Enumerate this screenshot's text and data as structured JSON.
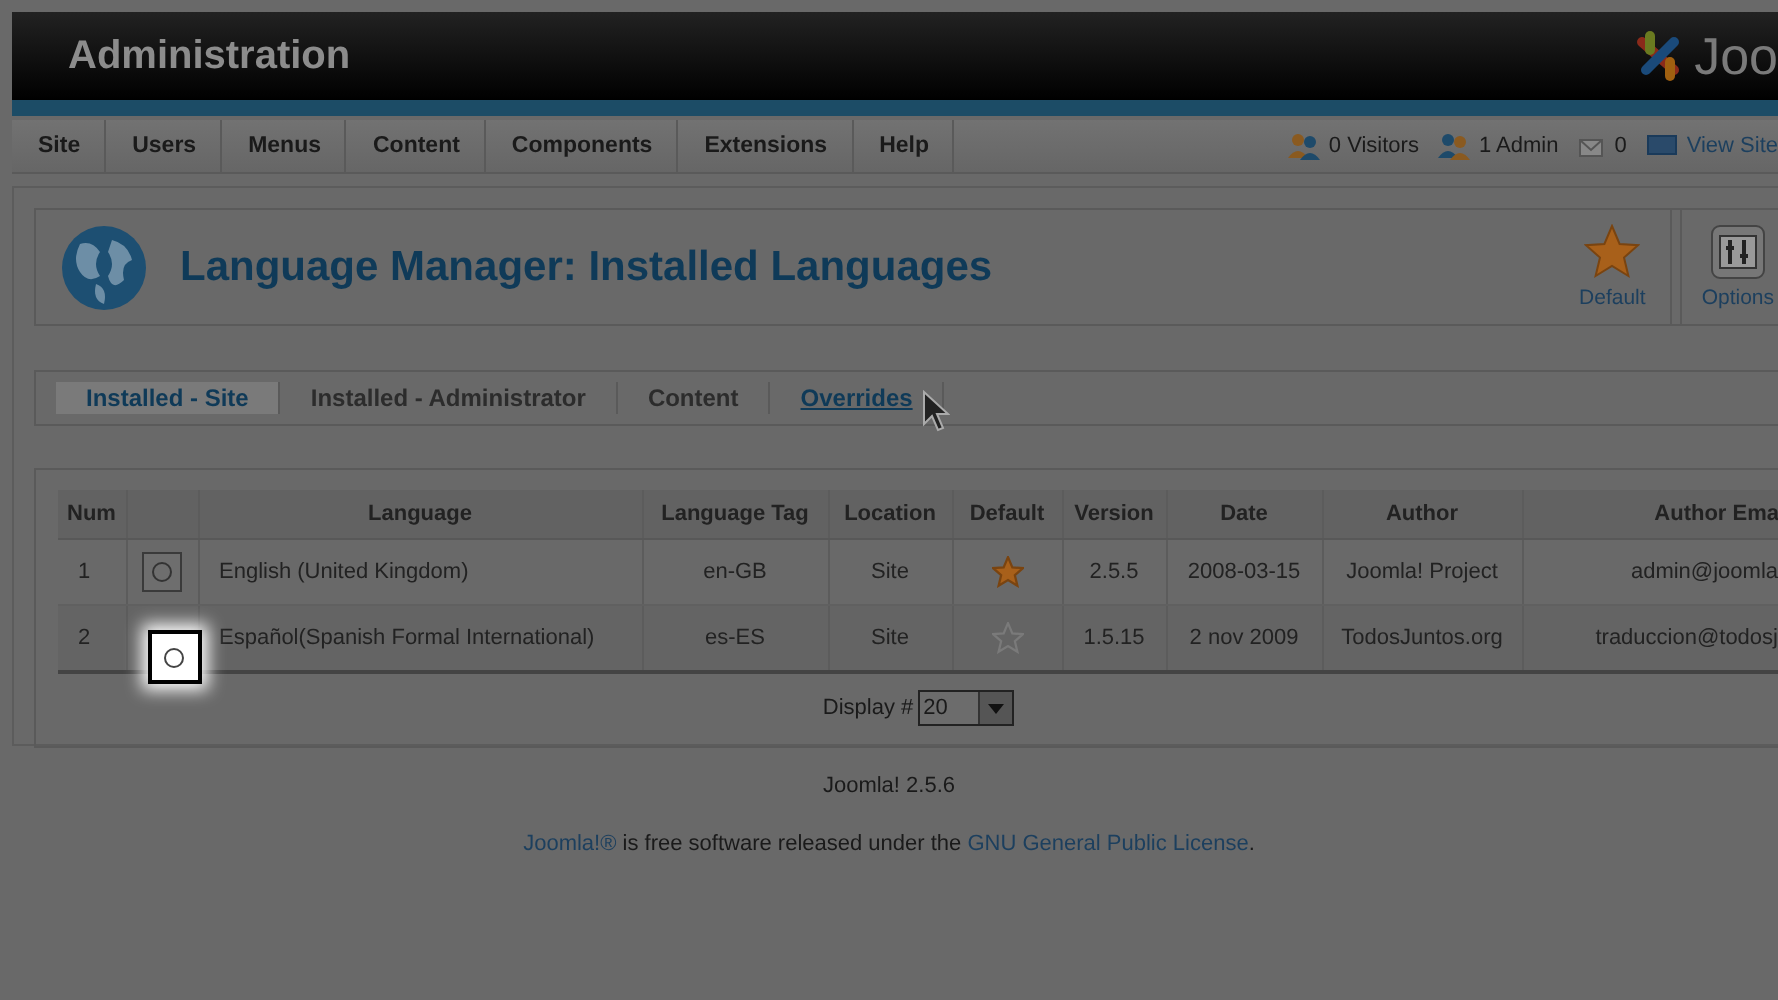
{
  "header": {
    "title": "Administration",
    "logo_text": "Joo"
  },
  "menu": [
    {
      "label": "Site"
    },
    {
      "label": "Users"
    },
    {
      "label": "Menus"
    },
    {
      "label": "Content"
    },
    {
      "label": "Components"
    },
    {
      "label": "Extensions"
    },
    {
      "label": "Help"
    }
  ],
  "status": [
    {
      "kind": "visitors",
      "label": "0 Visitors"
    },
    {
      "kind": "admins",
      "label": "1 Admin"
    },
    {
      "kind": "messages",
      "label": "0"
    },
    {
      "kind": "view",
      "label": "View Site"
    }
  ],
  "page_title": "Language Manager: Installed Languages",
  "toolbar": [
    {
      "kind": "default",
      "label": "Default"
    },
    {
      "kind": "options",
      "label": "Options"
    }
  ],
  "tabs": [
    {
      "label": "Installed - Site",
      "selected": true,
      "hovered": false
    },
    {
      "label": "Installed - Administrator",
      "selected": false,
      "hovered": false
    },
    {
      "label": "Content",
      "selected": false,
      "hovered": false
    },
    {
      "label": "Overrides",
      "selected": false,
      "hovered": true
    }
  ],
  "table": {
    "columns": [
      "Num",
      "Language",
      "Language Tag",
      "Location",
      "Default",
      "Version",
      "Date",
      "Author",
      "Author Ema"
    ],
    "rows": [
      {
        "num": "1",
        "selected": false,
        "highlighted": false,
        "language": "English (United Kingdom)",
        "tag": "en-GB",
        "location": "Site",
        "default": true,
        "version": "2.5.5",
        "date": "2008-03-15",
        "author": "Joomla! Project",
        "email": "admin@joomla"
      },
      {
        "num": "2",
        "selected": false,
        "highlighted": true,
        "language": "Español(Spanish Formal International)",
        "tag": "es-ES",
        "location": "Site",
        "default": false,
        "version": "1.5.15",
        "date": "2 nov 2009",
        "author": "TodosJuntos.org",
        "email": "traduccion@todosj"
      }
    ],
    "display_label": "Display #",
    "display_value": "20"
  },
  "footer": {
    "version": "Joomla! 2.5.6",
    "brand_link": "Joomla!®",
    "text": " is free software released under the ",
    "license_link": "GNU General Public License",
    "end": "."
  }
}
